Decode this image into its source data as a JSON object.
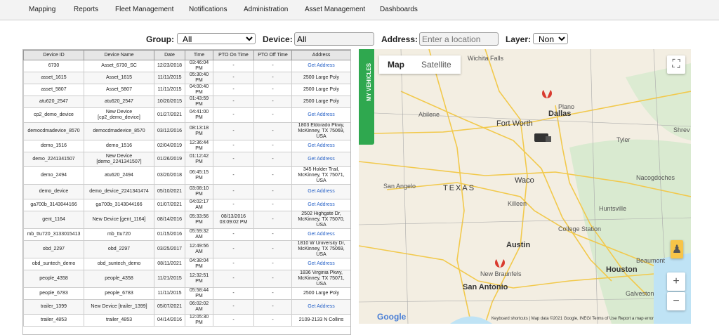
{
  "nav": [
    "Mapping",
    "Reports",
    "Fleet Management",
    "Notifications",
    "Administration",
    "Asset Management",
    "Dashboards"
  ],
  "filters": {
    "group_label": "Group:",
    "group_value": "All",
    "device_label": "Device:",
    "device_value": "All",
    "address_label": "Address:",
    "address_placeholder": "Enter a location",
    "layer_label": "Layer:",
    "layer_value": "None"
  },
  "table": {
    "headers": [
      "Device ID",
      "Device Name",
      "Date",
      "Time",
      "PTO On Time",
      "PTO Off Time",
      "Address"
    ],
    "rows": [
      [
        "6730",
        "Asset_6730_SC",
        "12/23/2018",
        "03:46:04 PM",
        "-",
        "-",
        "Get Address"
      ],
      [
        "asset_1615",
        "Asset_1615",
        "11/11/2015",
        "05:30:40 PM",
        "-",
        "-",
        "2500 Large Poly"
      ],
      [
        "asset_5807",
        "Asset_5807",
        "11/11/2015",
        "04:00:40 PM",
        "-",
        "-",
        "2500 Large Poly"
      ],
      [
        "atu620_2547",
        "atu620_2547",
        "10/20/2015",
        "01:43:59 PM",
        "-",
        "-",
        "2500 Large Poly"
      ],
      [
        "cp2_demo_device",
        "New Device [cp2_demo_device]",
        "01/27/2021",
        "04:41:00 PM",
        "-",
        "-",
        "Get Address"
      ],
      [
        "democdmadevice_8570",
        "democdmadevice_8570",
        "03/12/2016",
        "08:13:18 PM",
        "-",
        "-",
        "1803 Eldorado Pkwy, McKinney, TX 75069, USA"
      ],
      [
        "demo_1516",
        "demo_1516",
        "02/04/2019",
        "12:36:44 PM",
        "-",
        "-",
        "Get Address"
      ],
      [
        "demo_2241341507",
        "New Device [demo_2241341507]",
        "01/26/2019",
        "01:12:42 PM",
        "-",
        "-",
        "Get Address"
      ],
      [
        "demo_2494",
        "atu620_2494",
        "03/20/2018",
        "06:45:15 PM",
        "-",
        "-",
        "345 Holder Trail, McKinney, TX 75071, USA"
      ],
      [
        "demo_device",
        "demo_device_2241341474",
        "05/10/2021",
        "03:08:10 PM",
        "-",
        "-",
        "Get Address"
      ],
      [
        "ga700b_3143044166",
        "ga700b_3143044166",
        "01/07/2021",
        "04:02:17 AM",
        "-",
        "-",
        "Get Address"
      ],
      [
        "gent_1164",
        "New Device [gent_1164]",
        "08/14/2016",
        "05:33:56 PM",
        "08/13/2016 03:09:02 PM",
        "-",
        "2502 Highgate Dr, McKinney, TX 75070, USA"
      ],
      [
        "mb_ttu720_3133015413",
        "mb_ttu720",
        "01/15/2016",
        "05:59:32 AM",
        "-",
        "-",
        "Get Address"
      ],
      [
        "obd_2297",
        "obd_2297",
        "03/25/2017",
        "12:49:56 AM",
        "-",
        "-",
        "1810 W University Dr, McKinney, TX 75069, USA"
      ],
      [
        "obd_suntech_demo",
        "obd_suntech_demo",
        "08/11/2021",
        "04:38:04 PM",
        "-",
        "-",
        "Get Address"
      ],
      [
        "people_4358",
        "people_4358",
        "11/21/2015",
        "12:32:51 PM",
        "-",
        "-",
        "1836 Virginia Pkwy, McKinney, TX 75071, USA"
      ],
      [
        "people_6783",
        "people_6783",
        "11/11/2015",
        "05:58:44 PM",
        "-",
        "-",
        "2500 Large Poly"
      ],
      [
        "trailer_1399",
        "New Device [trailer_1399]",
        "05/07/2021",
        "06:02:02 AM",
        "-",
        "-",
        "Get Address"
      ],
      [
        "trailer_4853",
        "trailer_4853",
        "04/14/2016",
        "12:05:30 PM",
        "-",
        "-",
        "2109-2133 N Collins"
      ]
    ]
  },
  "map": {
    "vehicles_tab": "MY VEHICLES",
    "map_btn": "Map",
    "satellite_btn": "Satellite",
    "labels": {
      "wichita": "Wichita Falls",
      "abilene": "Abilene",
      "fortworth": "Fort Worth",
      "dallas": "Dallas",
      "tyler": "Tyler",
      "sanangelo": "San Angelo",
      "texas": "TEXAS",
      "waco": "Waco",
      "killeen": "Killeen",
      "collegestation": "College Station",
      "austin": "Austin",
      "newbraunfels": "New Braunfels",
      "sanantonio": "San Antonio",
      "houston": "Houston",
      "beaumont": "Beaumont",
      "galveston": "Galveston",
      "nacogdoches": "Nacogdoches",
      "huntsville": "Huntsville",
      "shrev": "Shrev",
      "plano": "Plano"
    },
    "google": "Google",
    "footer": "Keyboard shortcuts  |  Map data ©2021 Google, INEGI    Terms of Use    Report a map error",
    "zoom_in": "+",
    "zoom_out": "−"
  },
  "colors": {
    "tab_green": "#2fa84f",
    "link_blue": "#2a64c8",
    "pin_red": "#d93a2f"
  }
}
